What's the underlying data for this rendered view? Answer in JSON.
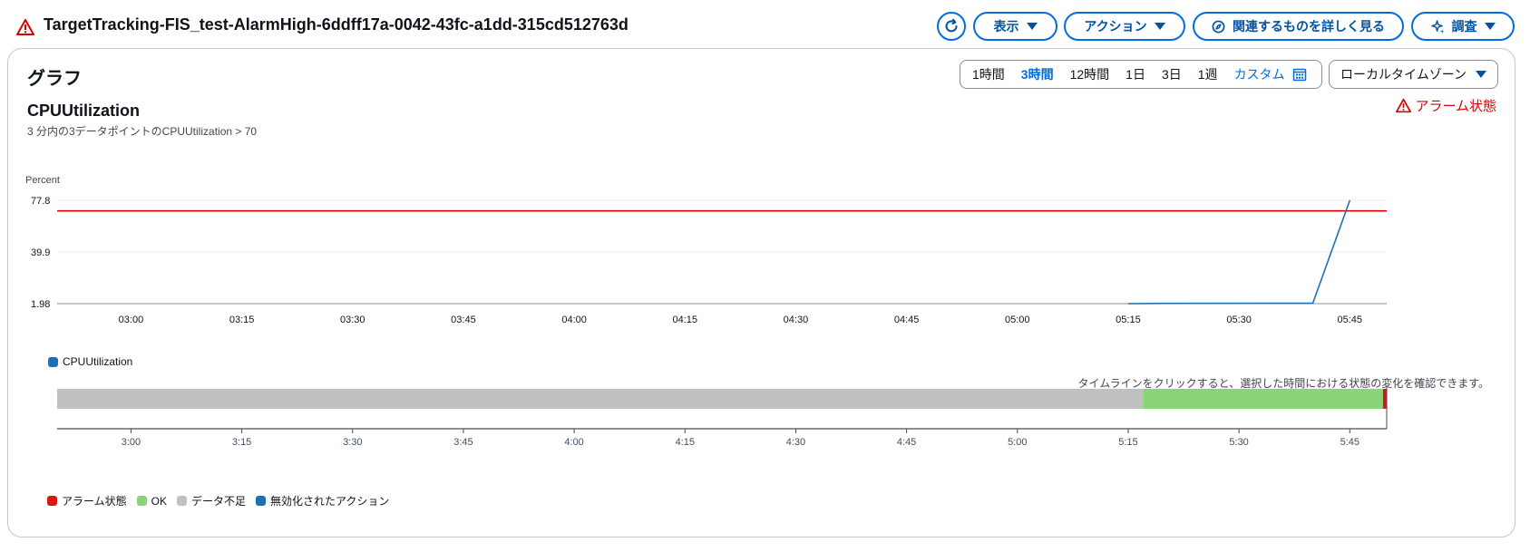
{
  "header": {
    "title": "TargetTracking-FIS_test-AlarmHigh-6ddff17a-0042-43fc-a1dd-315cd512763d",
    "buttons": {
      "view": "表示",
      "actions": "アクション",
      "related": "関連するものを詳しく見る",
      "investigate": "調査"
    }
  },
  "panel": {
    "title": "グラフ",
    "time_ranges": [
      "1時間",
      "3時間",
      "12時間",
      "1日",
      "3日",
      "1週",
      "カスタム"
    ],
    "selected_range": "3時間",
    "timezone": "ローカルタイムゾーン",
    "metric_name": "CPUUtilization",
    "metric_condition": "3 分内の3データポイントのCPUUtilization > 70",
    "alarm_status": "アラーム状態",
    "timeline_hint": "タイムラインをクリックすると、選択した時間における状態の変化を確認できます。",
    "metric_legend": "CPUUtilization",
    "state_legend": [
      {
        "label": "アラーム状態",
        "color": "#d91515"
      },
      {
        "label": "OK",
        "color": "#89d479"
      },
      {
        "label": "データ不足",
        "color": "#c0c0c0"
      },
      {
        "label": "無効化されたアクション",
        "color": "#1f6fb2"
      }
    ]
  },
  "chart_data": {
    "type": "line",
    "ylabel": "Percent",
    "y_ticks": [
      "1.98",
      "39.9",
      "77.8"
    ],
    "ylim": [
      1.98,
      77.8
    ],
    "x_ticks": [
      "03:00",
      "03:15",
      "03:30",
      "03:45",
      "04:00",
      "04:15",
      "04:30",
      "04:45",
      "05:00",
      "05:15",
      "05:30",
      "05:45"
    ],
    "threshold": 70,
    "threshold_color": "#db0000",
    "series": [
      {
        "name": "CPUUtilization",
        "color": "#1f6fb2",
        "points": [
          [
            "05:15",
            1.98
          ],
          [
            "05:20",
            2.2
          ],
          [
            "05:40",
            2.4
          ],
          [
            "05:45",
            77.8
          ]
        ]
      }
    ],
    "timeline": {
      "x_ticks": [
        "3:00",
        "3:15",
        "3:30",
        "3:45",
        "4:00",
        "4:15",
        "4:30",
        "4:45",
        "5:00",
        "5:15",
        "5:30",
        "5:45"
      ],
      "segments": [
        {
          "state": "データ不足",
          "start": "02:50",
          "end": "05:17",
          "color": "#c0c0c0"
        },
        {
          "state": "OK",
          "start": "05:17",
          "end": "05:49.5",
          "color": "#89d479"
        },
        {
          "state": "アラーム状態",
          "start": "05:49.5",
          "end": "05:50",
          "color": "#d91515"
        }
      ]
    }
  }
}
